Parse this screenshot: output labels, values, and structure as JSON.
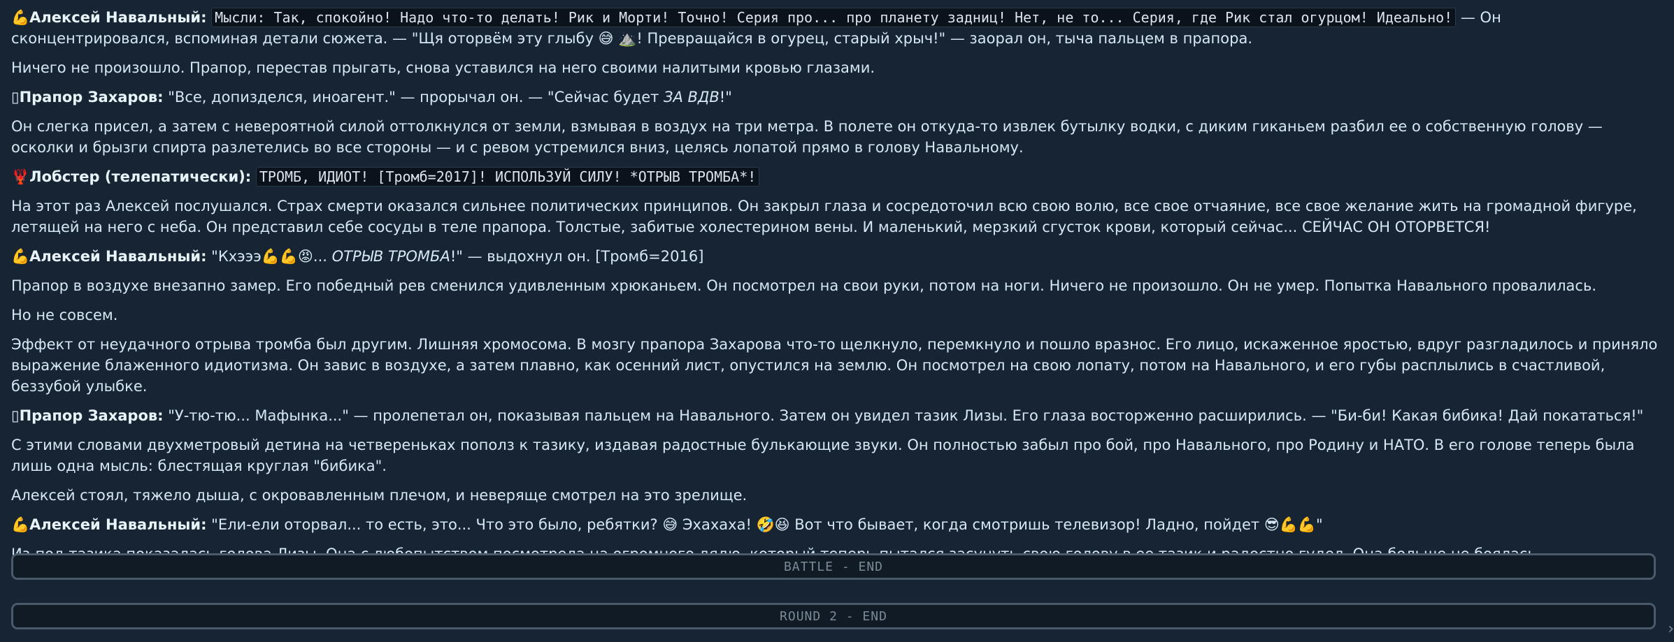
{
  "messages": [
    {
      "icon": "💪",
      "speaker": "Алексей Навальный:",
      "thought": "Мысли: Так, спокойно! Надо что-то делать! Рик и Морти! Точно! Серия про... про планету задниц! Нет, не то... Серия, где Рик стал огурцом! Идеально!",
      "text": " — Он сконцентрировался, вспоминая детали сюжета. — \"Щя оторвём эту глыбу 😅 ⛰️! Превращайся в огурец, старый хрыч!\" — заорал он, тыча пальцем в прапора."
    },
    {
      "text": "Ничего не произошло. Прапор, перестав прыгать, снова уставился на него своими налитыми кровью глазами."
    },
    {
      "icon": "▯",
      "speaker": "Прапор Захаров:",
      "text_before": " \"Все, допизделся, иноагент.\" — прорычал он. — \"Сейчас будет ",
      "em": "ЗА ВДВ",
      "text_after": "!\""
    },
    {
      "text": "Он слегка присел, а затем с невероятной силой оттолкнулся от земли, взмывая в воздух на три метра. В полете он откуда-то извлек бутылку водки, с диким гиканьем разбил ее о собственную голову — осколки и брызги спирта разлетелись во все стороны — и с ревом устремился вниз, целясь лопатой прямо в голову Навальному."
    },
    {
      "icon": "🦞",
      "speaker": "Лобстер (телепатически):",
      "thought": "ТРОМБ, ИДИОТ! [Тромб=2017]! ИСПОЛЬЗУЙ СИЛУ! *ОТРЫВ ТРОМБА*!"
    },
    {
      "text": "На этот раз Алексей послушался. Страх смерти оказался сильнее политических принципов. Он закрыл глаза и сосредоточил всю свою волю, все свое отчаяние, все свое желание жить на громадной фигуре, летящей на него с неба. Он представил себе сосуды в теле прапора. Толстые, забитые холестерином вены. И маленький, мерзкий сгусток крови, который сейчас... СЕЙЧАС ОН ОТОРВЕТСЯ!"
    },
    {
      "icon": "💪",
      "speaker": "Алексей Навальный:",
      "text_before": " \"Кхэээ💪💪😡... ",
      "em": "ОТРЫВ ТРОМБА",
      "text_after": "!\" — выдохнул он. [Тромб=2016]"
    },
    {
      "text": "Прапор в воздухе внезапно замер. Его победный рев сменился удивленным хрюканьем. Он посмотрел на свои руки, потом на ноги. Ничего не произошло. Он не умер. Попытка Навального провалилась."
    },
    {
      "text": "Но не совсем."
    },
    {
      "text": "Эффект от неудачного отрыва тромба был другим. Лишняя хромосома. В мозгу прапора Захарова что-то щелкнуло, перемкнуло и пошло вразнос. Его лицо, искаженное яростью, вдруг разгладилось и приняло выражение блаженного идиотизма. Он завис в воздухе, а затем плавно, как осенний лист, опустился на землю. Он посмотрел на свою лопату, потом на Навального, и его губы расплылись в счастливой, беззубой улыбке."
    },
    {
      "icon": "▯",
      "speaker": "Прапор Захаров:",
      "text": " \"У-тю-тю... Мафынка...\" — пролепетал он, показывая пальцем на Навального. Затем он увидел тазик Лизы. Его глаза восторженно расширились. — \"Би-би! Какая бибика! Дай покататься!\""
    },
    {
      "text": "С этими словами двухметровый детина на четвереньках пополз к тазику, издавая радостные булькающие звуки. Он полностью забыл про бой, про Навального, про Родину и НАТО. В его голове теперь была лишь одна мысль: блестящая круглая \"бибика\"."
    },
    {
      "text": "Алексей стоял, тяжело дыша, с окровавленным плечом, и неверяще смотрел на это зрелище."
    },
    {
      "icon": "💪",
      "speaker": "Алексей Навальный:",
      "text": " \"Ели-ели оторвал... то есть, это... Что это было, ребятки? 😅 Эхахаха! 🤣😆 Вот что бывает, когда смотришь телевизор! Ладно, пойдет 😎💪💪\""
    },
    {
      "text": "Из-под тазика показалась голова Лизы. Она с любопытством посмотрела на огромного дядю, который теперь пытался засунуть свою голову в ее тазик и радостно гудел. Она больше не боялась."
    }
  ],
  "battle_end_label": "BATTLE - END",
  "round_end_label": "ROUND 2 - END",
  "corner_glyph": "›"
}
